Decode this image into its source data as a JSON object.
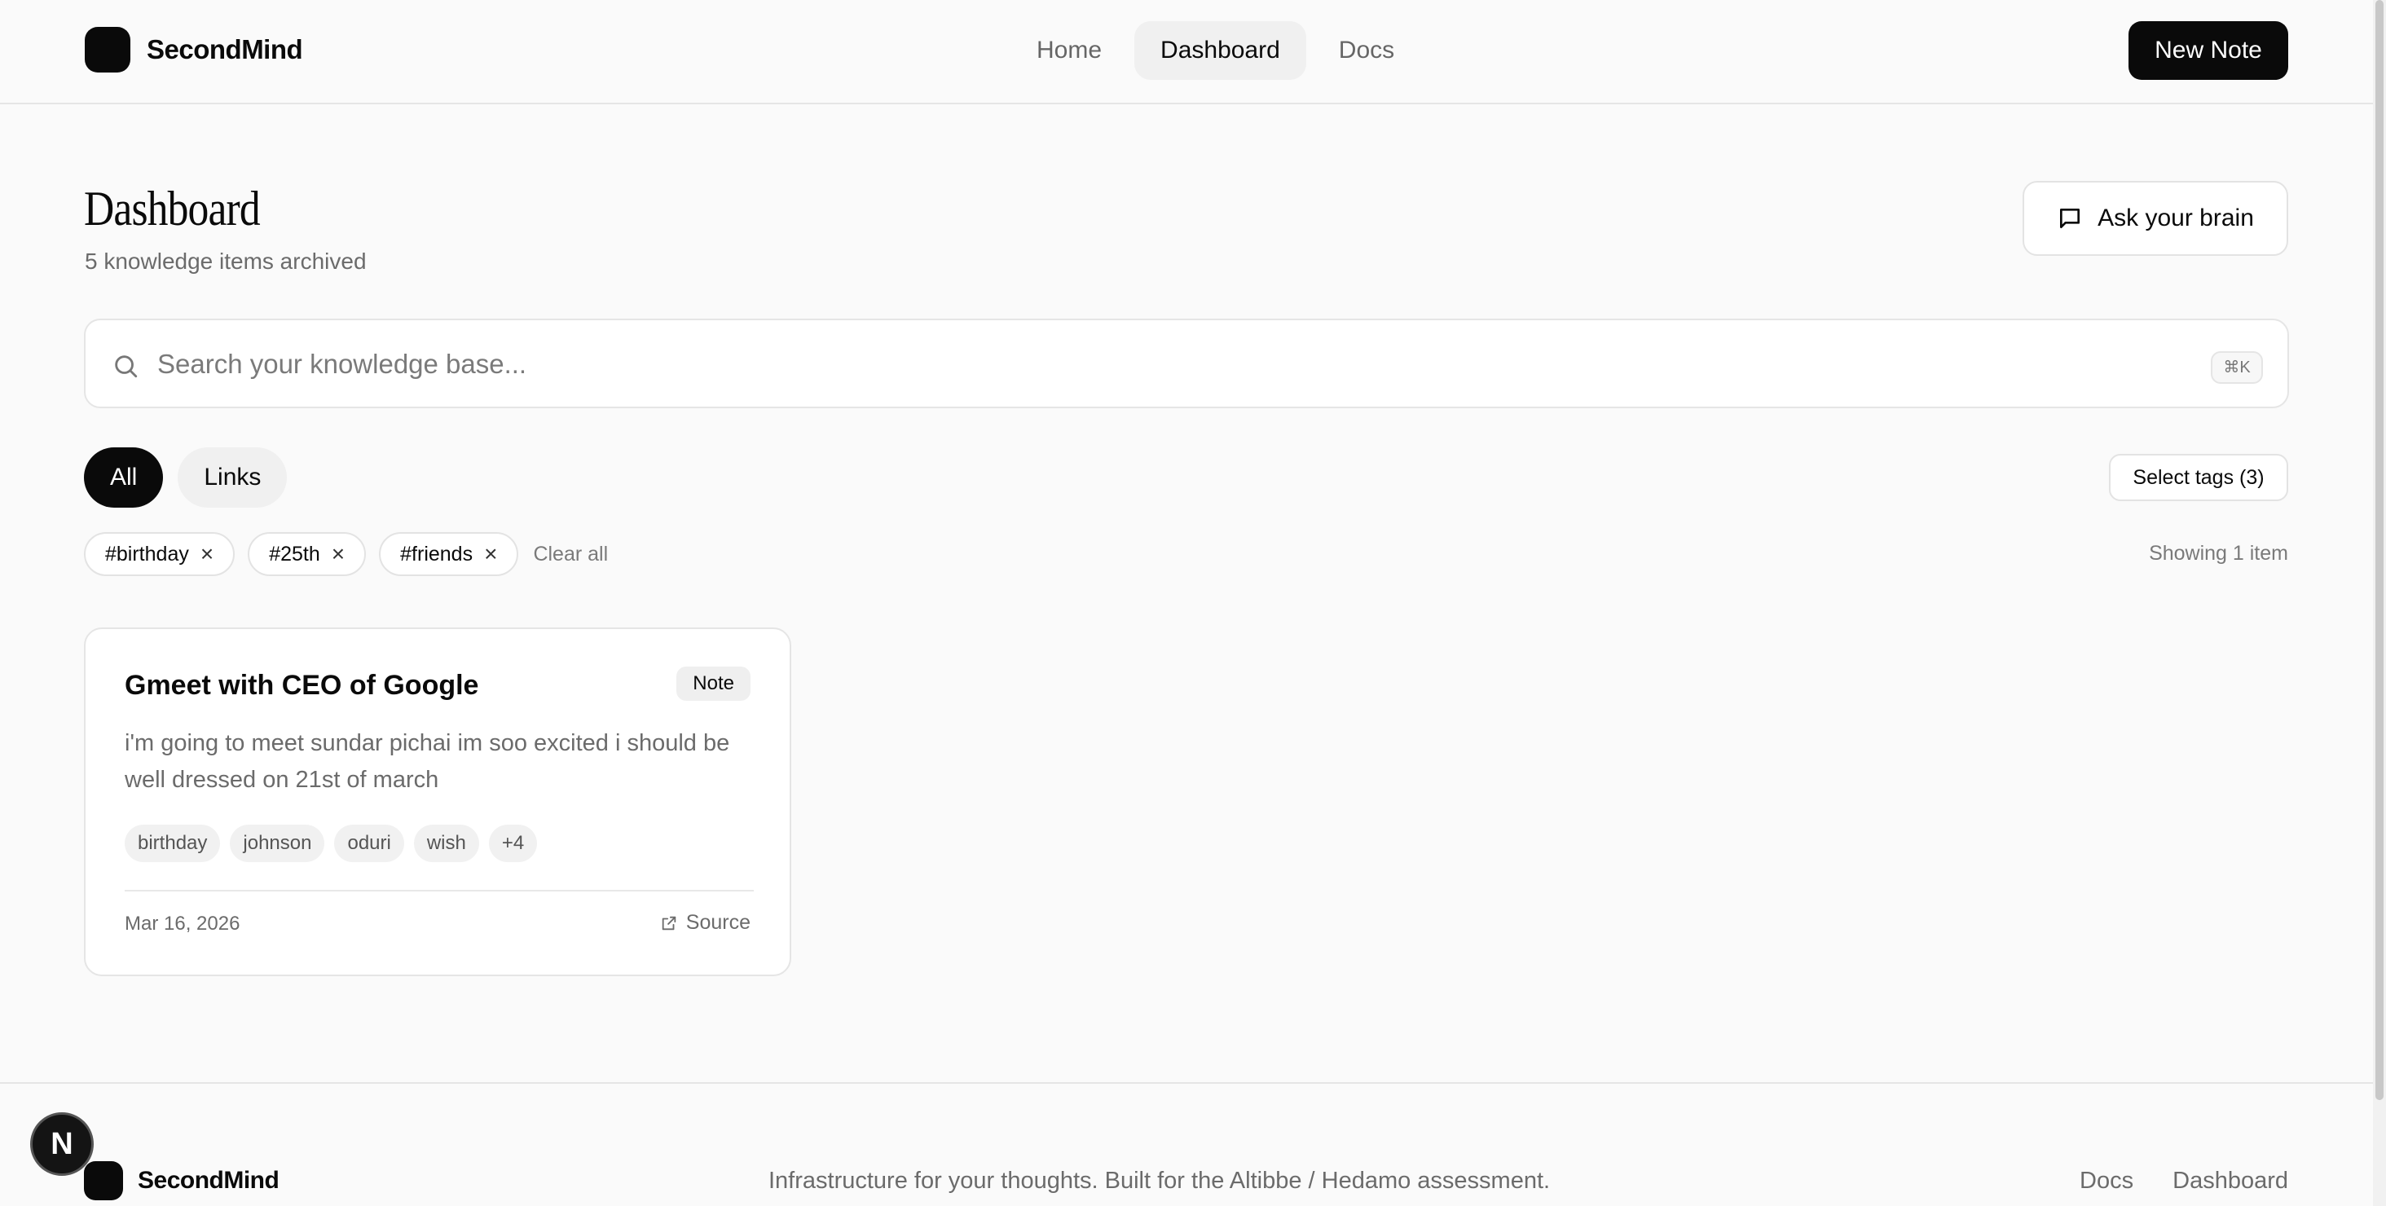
{
  "header": {
    "brand": "SecondMind",
    "nav": [
      {
        "label": "Home",
        "active": false
      },
      {
        "label": "Dashboard",
        "active": true
      },
      {
        "label": "Docs",
        "active": false
      }
    ],
    "new_note_label": "New Note"
  },
  "page": {
    "title": "Dashboard",
    "subtitle": "5 knowledge items archived",
    "ask_label": "Ask your brain"
  },
  "search": {
    "placeholder": "Search your knowledge base...",
    "value": "",
    "shortcut": "⌘K"
  },
  "filters": {
    "types": [
      {
        "label": "All",
        "active": true
      },
      {
        "label": "Links",
        "active": false
      }
    ],
    "select_tags_label": "Select tags (3)",
    "selected_tags": [
      "#birthday",
      "#25th",
      "#friends"
    ],
    "clear_all_label": "Clear all",
    "showing_label": "Showing 1 item"
  },
  "items": [
    {
      "title": "Gmeet with CEO of Google",
      "badge": "Note",
      "body": "i'm going to meet sundar pichai im soo excited i should be well dressed on 21st of march",
      "tags": [
        "birthday",
        "johnson",
        "oduri",
        "wish",
        "+4"
      ],
      "date": "Mar 16, 2026",
      "source_label": "Source"
    }
  ],
  "footer": {
    "brand": "SecondMind",
    "tagline": "Infrastructure for your thoughts. Built for the Altibbe / Hedamo assessment.",
    "links": [
      "Docs",
      "Dashboard"
    ]
  },
  "dev_indicator": "N",
  "colors": {
    "background": "#fafafa",
    "primary": "#0a0a0a",
    "muted_text": "#6b6b6b",
    "border": "#e5e5e5"
  }
}
